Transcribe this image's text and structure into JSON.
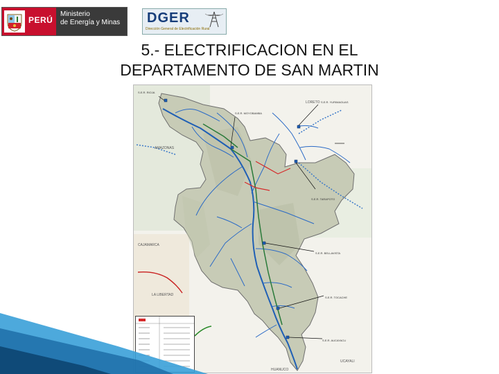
{
  "header": {
    "country_logo_word": "PERÚ",
    "ministry_line1": "Ministerio",
    "ministry_line2": "de Energía y Minas",
    "dger_logo_word": "DGER",
    "dger_subtitle": "Dirección General de Electrificación Rural"
  },
  "title": {
    "line1": "5.- ELECTRIFICACION EN EL",
    "line2": "DEPARTAMENTO DE SAN MARTIN"
  },
  "map": {
    "regions": {
      "loreto": "LORETO",
      "amazonas": "AMAZONAS",
      "la_libertad": "LA LIBERTAD",
      "huanuco": "HUANUCO",
      "ucayali": "UCAYALI",
      "cajamarca": "CAJAMARCA"
    },
    "substations": {
      "rioja": "S.E.R. RIOJA",
      "moyobamba": "S.E.R. MOYOBAMBA",
      "yurimaguas": "S.E.R. YURIMAGUAS",
      "tarapoto": "S.E.R. TARAPOTO",
      "bellavista": "S.E.R. BELLAVISTA",
      "tocache": "S.E.R. TOCACHE",
      "aucayacu": "S.E.R. AUCAYACU"
    },
    "colors": {
      "department": "#c7cbb6",
      "rivers": "#1f5fb5",
      "lines": "#2a7a3a",
      "proposed": "#d62a2a"
    }
  }
}
